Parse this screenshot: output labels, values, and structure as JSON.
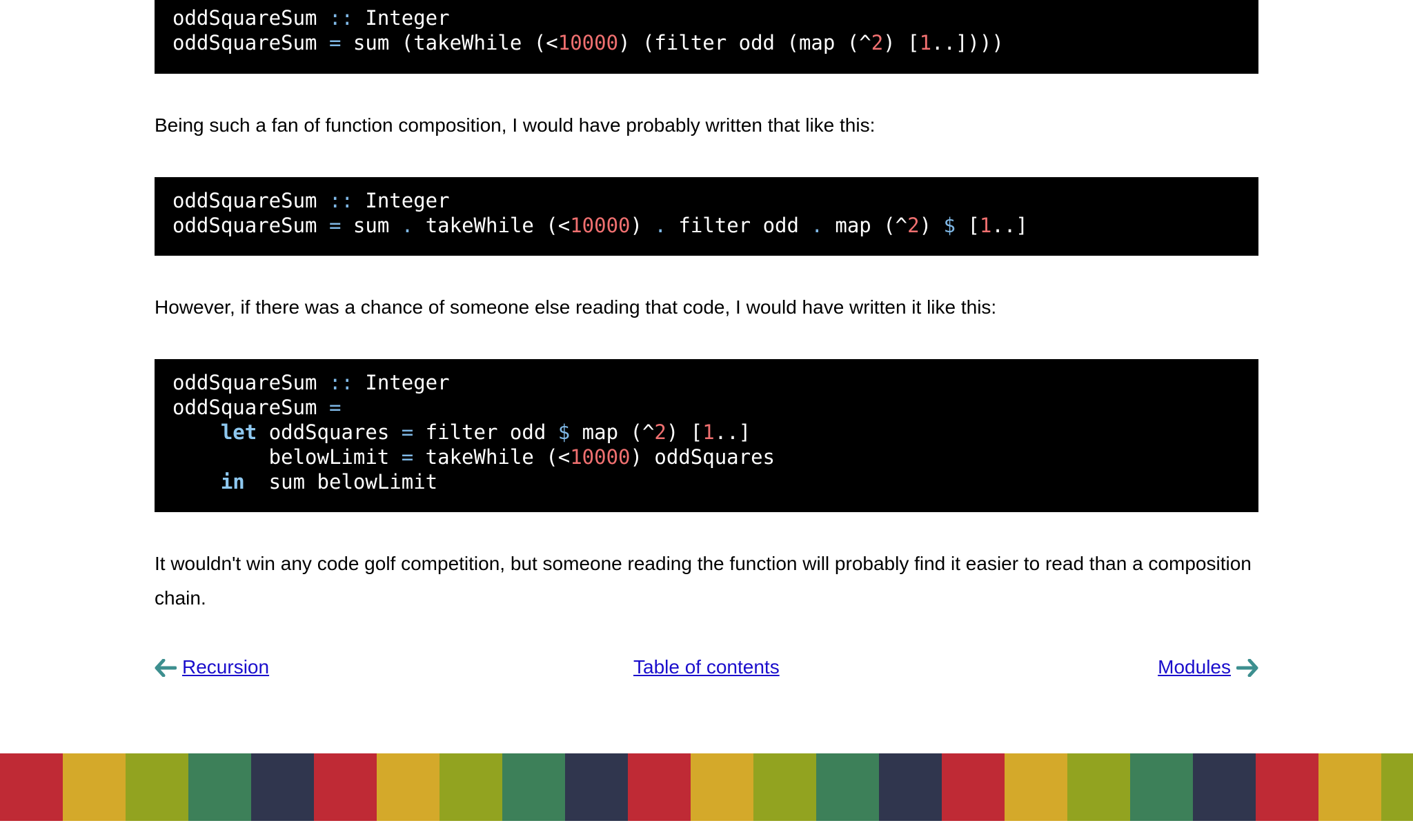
{
  "code_blocks": [
    {
      "lines": [
        [
          [
            "oddSquareSum ",
            "plain"
          ],
          [
            "::",
            "op"
          ],
          [
            " Integer",
            "plain"
          ]
        ],
        [
          [
            "oddSquareSum ",
            "plain"
          ],
          [
            "=",
            "op"
          ],
          [
            " sum (takeWhile (<",
            "plain"
          ],
          [
            "10000",
            "num"
          ],
          [
            ") (filter odd (map (^",
            "plain"
          ],
          [
            "2",
            "num"
          ],
          [
            ") [",
            "plain"
          ],
          [
            "1",
            "num"
          ],
          [
            "..])))",
            "plain"
          ]
        ]
      ]
    },
    {
      "lines": [
        [
          [
            "oddSquareSum ",
            "plain"
          ],
          [
            "::",
            "op"
          ],
          [
            " Integer",
            "plain"
          ]
        ],
        [
          [
            "oddSquareSum ",
            "plain"
          ],
          [
            "=",
            "op"
          ],
          [
            " sum ",
            "plain"
          ],
          [
            ".",
            "op"
          ],
          [
            " takeWhile (<",
            "plain"
          ],
          [
            "10000",
            "num"
          ],
          [
            ") ",
            "plain"
          ],
          [
            ".",
            "op"
          ],
          [
            " filter odd ",
            "plain"
          ],
          [
            ".",
            "op"
          ],
          [
            " map (^",
            "plain"
          ],
          [
            "2",
            "num"
          ],
          [
            ") ",
            "plain"
          ],
          [
            "$",
            "op"
          ],
          [
            " [",
            "plain"
          ],
          [
            "1",
            "num"
          ],
          [
            "..]",
            "plain"
          ]
        ]
      ]
    },
    {
      "lines": [
        [
          [
            "oddSquareSum ",
            "plain"
          ],
          [
            "::",
            "op"
          ],
          [
            " Integer",
            "plain"
          ]
        ],
        [
          [
            "oddSquareSum ",
            "plain"
          ],
          [
            "=",
            "op"
          ]
        ],
        [
          [
            "    ",
            "plain"
          ],
          [
            "let",
            "kw"
          ],
          [
            " oddSquares ",
            "plain"
          ],
          [
            "=",
            "op"
          ],
          [
            " filter odd ",
            "plain"
          ],
          [
            "$",
            "op"
          ],
          [
            " map (^",
            "plain"
          ],
          [
            "2",
            "num"
          ],
          [
            ") [",
            "plain"
          ],
          [
            "1",
            "num"
          ],
          [
            "..]",
            "plain"
          ]
        ],
        [
          [
            "        belowLimit ",
            "plain"
          ],
          [
            "=",
            "op"
          ],
          [
            " takeWhile (<",
            "plain"
          ],
          [
            "10000",
            "num"
          ],
          [
            ") oddSquares",
            "plain"
          ]
        ],
        [
          [
            "    ",
            "plain"
          ],
          [
            "in",
            "kw"
          ],
          [
            "  sum belowLimit",
            "plain"
          ]
        ]
      ]
    }
  ],
  "paragraphs": {
    "p1": "Being such a fan of function composition, I would have probably written that like this:",
    "p2": "However, if there was a chance of someone else reading that code, I would have written it like this:",
    "p3": "It wouldn't win any code golf competition, but someone reading the function will probably find it easier to read than a composition chain."
  },
  "nav": {
    "prev_label": "Recursion",
    "toc_label": "Table of contents",
    "next_label": "Modules",
    "prev_icon": "left-arrow-icon",
    "next_icon": "right-arrow-icon",
    "arrow_color": "#3d8f8f",
    "link_color": "#1a0dcc"
  },
  "footer": {
    "stripe_colors": [
      "#bf2a35",
      "#d4a92a",
      "#92a320",
      "#3d8059",
      "#30364e"
    ]
  },
  "theme": {
    "code_bg": "#000000",
    "code_text": "#ffffff",
    "code_operator": "#7fb8e6",
    "code_number": "#f07070",
    "code_keyword": "#8ec8f0"
  }
}
